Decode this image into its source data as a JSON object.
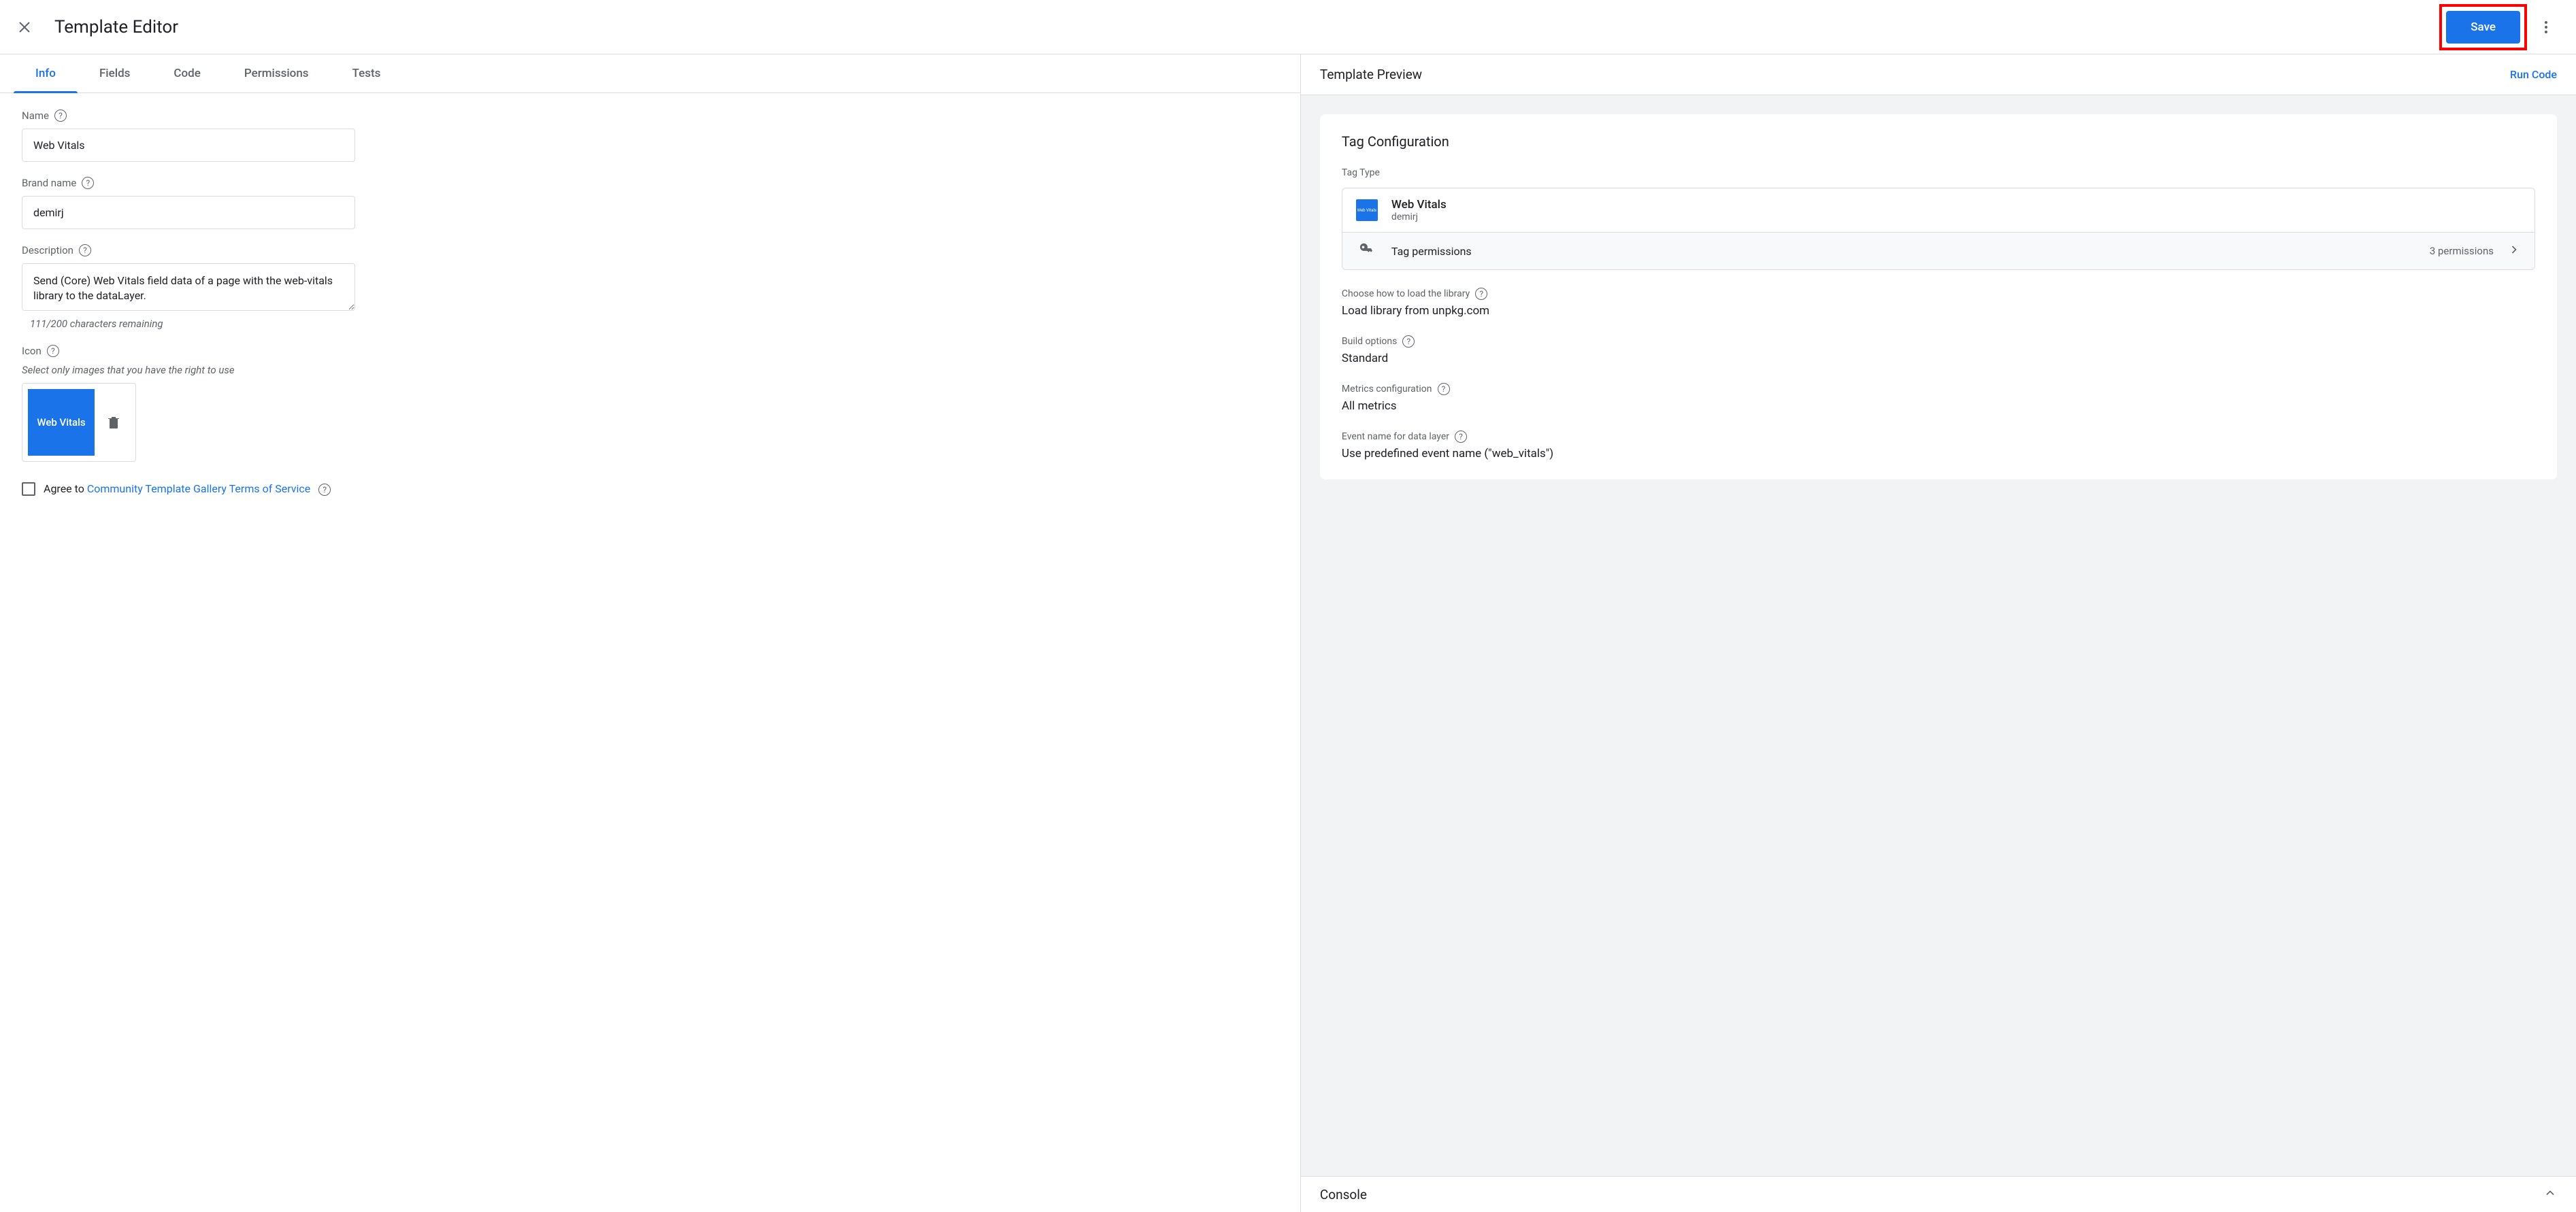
{
  "header": {
    "title": "Template Editor",
    "save_label": "Save"
  },
  "tabs": {
    "info": "Info",
    "fields": "Fields",
    "code": "Code",
    "permissions": "Permissions",
    "tests": "Tests"
  },
  "form": {
    "name_label": "Name",
    "name_value": "Web Vitals",
    "brand_label": "Brand name",
    "brand_value": "demirj",
    "description_label": "Description",
    "description_value": "Send (Core) Web Vitals field data of a page with the web-vitals library to the dataLayer.",
    "char_count": "111/200 characters remaining",
    "icon_label": "Icon",
    "icon_hint": "Select only images that you have the right to use",
    "icon_preview_text": "Web Vitals",
    "agree_prefix": "Agree to ",
    "agree_link": "Community Template Gallery Terms of Service"
  },
  "preview": {
    "header_title": "Template Preview",
    "run_code": "Run Code",
    "card_title": "Tag Configuration",
    "tag_type_label": "Tag Type",
    "tag_name": "Web Vitals",
    "tag_brand": "demirj",
    "tag_icon_text": "Web Vitals",
    "permissions_label": "Tag permissions",
    "permissions_count": "3 permissions",
    "load_label": "Choose how to load the library",
    "load_value": "Load library from unpkg.com",
    "build_label": "Build options",
    "build_value": "Standard",
    "metrics_label": "Metrics configuration",
    "metrics_value": "All metrics",
    "event_label": "Event name for data layer",
    "event_value": "Use predefined event name (\"web_vitals\")"
  },
  "console": {
    "title": "Console"
  }
}
